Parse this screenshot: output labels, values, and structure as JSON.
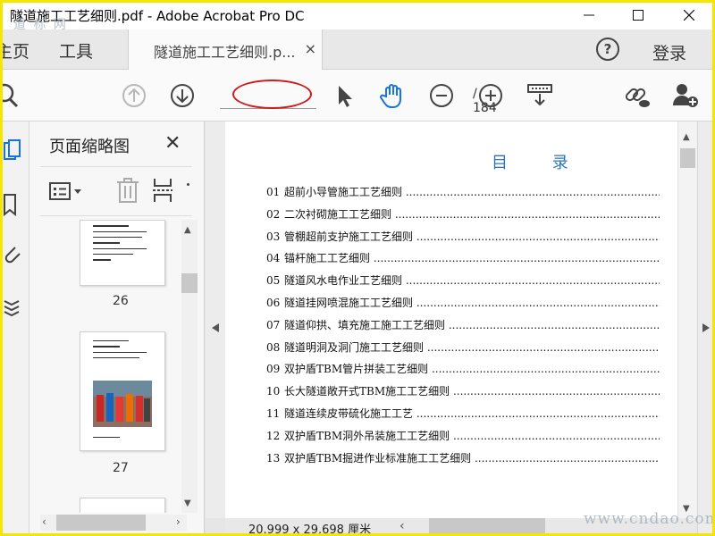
{
  "window": {
    "title": "隧道施工工艺细则.pdf - Adobe Acrobat Pro DC",
    "watermark_top": "道 标 网",
    "controls": [
      "minimize",
      "maximize",
      "close"
    ]
  },
  "tabs": {
    "home": "主页",
    "tools": "工具",
    "document": "隧道施工工艺细则.p...",
    "close_glyph": "×",
    "help": "?",
    "login": "登录"
  },
  "toolbar": {
    "page_current": "",
    "page_total": "/ 184",
    "icons": [
      "search-icon",
      "prev-page-icon",
      "next-page-icon",
      "select-cursor-icon",
      "hand-tool-icon",
      "zoom-out-icon",
      "zoom-in-icon",
      "page-display-icon",
      "share-link-icon",
      "add-user-icon"
    ]
  },
  "panel": {
    "title": "页面缩略图",
    "close_glyph": "✕",
    "thumbnails": [
      {
        "page": "26"
      },
      {
        "page": "27"
      }
    ]
  },
  "document": {
    "heading": "目 录",
    "toc": [
      {
        "num": "01",
        "text": "超前小导管施工工艺细则"
      },
      {
        "num": "02",
        "text": "二次衬砌施工工艺细则"
      },
      {
        "num": "03",
        "text": "管棚超前支护施工工艺细则"
      },
      {
        "num": "04",
        "text": "锚杆施工工艺细则"
      },
      {
        "num": "05",
        "text": "隧道风水电作业工艺细则"
      },
      {
        "num": "06",
        "text": "隧道挂网喷混施工工艺细则"
      },
      {
        "num": "07",
        "text": "隧道仰拱、填充施工施工工艺细则"
      },
      {
        "num": "08",
        "text": "隧道明洞及洞门施工工艺细则"
      },
      {
        "num": "09",
        "text": "双护盾TBM管片拼装工艺细则"
      },
      {
        "num": "10",
        "text": "长大隧道敞开式TBM施工工艺细则"
      },
      {
        "num": "11",
        "text": "隧道连续皮带硫化施工工艺"
      },
      {
        "num": "12",
        "text": "双护盾TBM洞外吊装施工工艺细则"
      },
      {
        "num": "13",
        "text": "双护盾TBM掘进作业标准施工工艺细则"
      }
    ]
  },
  "status": {
    "page_size": "20.999 x 29.698 厘米"
  },
  "watermark_bottom": "www.cndao.com",
  "colors": {
    "accent_blue": "#2e74b5",
    "hand_tool_blue": "#1473e6",
    "frame_yellow": "#f5e500",
    "annotation_red": "#d11b1b"
  }
}
